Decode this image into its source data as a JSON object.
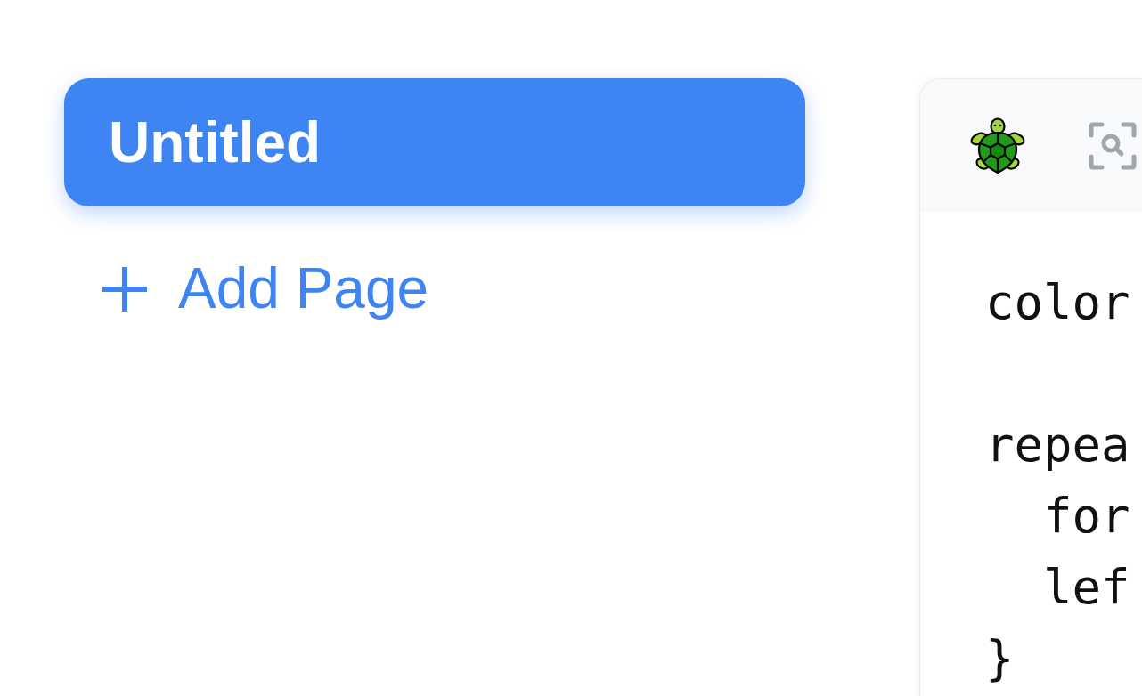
{
  "pages": [
    {
      "title": "Untitled",
      "selected": true
    }
  ],
  "add_page": {
    "label": "Add Page"
  },
  "editor": {
    "code": [
      {
        "kind": "statement",
        "text": "color"
      },
      {
        "kind": "blank"
      },
      {
        "kind": "block",
        "text": "repea",
        "children": [
          {
            "kind": "statement",
            "text": "for"
          },
          {
            "kind": "statement",
            "text": "lef"
          }
        ],
        "end": "}"
      }
    ]
  }
}
